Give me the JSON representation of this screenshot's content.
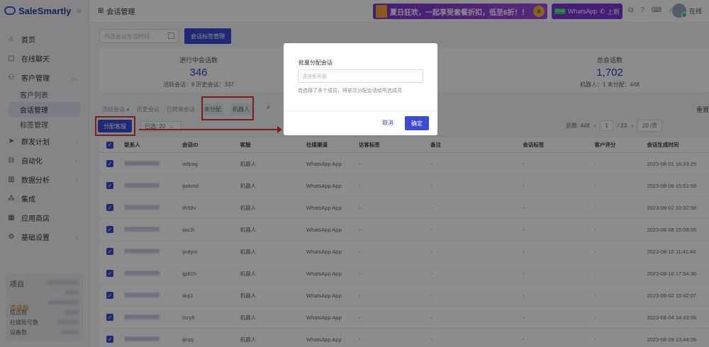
{
  "app": {
    "name": "SaleSmartly"
  },
  "sidebar": {
    "items": [
      {
        "label": "首页",
        "icon": "home-icon"
      },
      {
        "label": "在线聊天",
        "icon": "chat-icon"
      },
      {
        "label": "客户管理",
        "icon": "users-icon",
        "expanded": true,
        "children": [
          {
            "label": "客户列表"
          },
          {
            "label": "会话管理",
            "active": true
          },
          {
            "label": "标签管理"
          }
        ]
      },
      {
        "label": "群发计划",
        "icon": "send-icon"
      },
      {
        "label": "自动化",
        "icon": "robot-icon"
      },
      {
        "label": "数据分析",
        "icon": "chart-icon"
      },
      {
        "label": "集成",
        "icon": "integration-icon"
      },
      {
        "label": "应用商店",
        "icon": "apps-icon"
      },
      {
        "label": "基础设置",
        "icon": "settings-icon"
      }
    ],
    "plan": {
      "title": "项目",
      "level": "高级版",
      "rows": [
        "成员数",
        "社媒账号数",
        "设备数"
      ]
    }
  },
  "topbar": {
    "breadcrumb": "会话管理",
    "promo": "夏日狂欢，一起享受套餐折扣，低至6折！！",
    "whatsapp_badge": "New",
    "whatsapp_label": "WhatsApp",
    "whatsapp_action": "上新",
    "user_status": "在线"
  },
  "main": {
    "filter_placeholder": "筛选会话生成时间",
    "tag_button": "会话标签管理",
    "stats": [
      {
        "label": "进行中会话数",
        "value": "346",
        "detail": "活跃会话：9   历史会话：337"
      },
      {
        "label": "总会话数",
        "value": "1,702",
        "detail": "机器人：1   未分配：448"
      }
    ],
    "tabs": [
      "活跃会话",
      "历史会话",
      "已转来会话",
      "未分配",
      "机器人"
    ],
    "reset": "重置",
    "assign_button": "分配客服",
    "selected": "已选: 20",
    "pager": {
      "total": "总数: 448",
      "page": "1",
      "pages": "/ 23",
      "size": "20 /页"
    }
  },
  "table": {
    "columns": [
      "联系人",
      "会话ID",
      "客服",
      "社媒渠道",
      "访客标签",
      "备注",
      "会话标签",
      "客户评分",
      "会话生成时间"
    ],
    "rows": [
      [
        "ixdpag",
        "机器人",
        "WhatsApp App",
        "-",
        "-",
        "-",
        "-",
        "2023-08-01 16:33:25"
      ],
      [
        "ijwkmd",
        "机器人",
        "WhatsApp App",
        "-",
        "-",
        "-",
        "-",
        "2023-08-08 15:52:59"
      ],
      [
        "iih58v",
        "机器人",
        "WhatsApp App",
        "-",
        "-",
        "-",
        "-",
        "2023-08-02 10:32:58"
      ],
      [
        "ijac2i",
        "机器人",
        "WhatsApp App",
        "-",
        "-",
        "-",
        "-",
        "2023-08-08 15:09:55"
      ],
      [
        "ijn8ym",
        "机器人",
        "WhatsApp App",
        "-",
        "-",
        "-",
        "-",
        "2023-08-10 11:41:46"
      ],
      [
        "ijp81h",
        "机器人",
        "WhatsApp App",
        "-",
        "-",
        "-",
        "-",
        "2023-08-10 17:54:36"
      ],
      [
        "iiinj3",
        "机器人",
        "WhatsApp App",
        "-",
        "-",
        "-",
        "-",
        "2023-08-02 15:42:07"
      ],
      [
        "iisry5",
        "机器人",
        "WhatsApp App",
        "-",
        "-",
        "-",
        "-",
        "2023-08-04 14:43:59"
      ],
      [
        "ijirqq",
        "机器人",
        "WhatsApp App",
        "-",
        "-",
        "-",
        "-",
        "2023-08-09 13:44:09"
      ]
    ]
  },
  "modal": {
    "title": "批量分配会话",
    "placeholder": "请搜索客服",
    "hint": "若选择了多个成员，将依次分配会话给所选成员",
    "cancel": "取消",
    "confirm": "确定"
  }
}
